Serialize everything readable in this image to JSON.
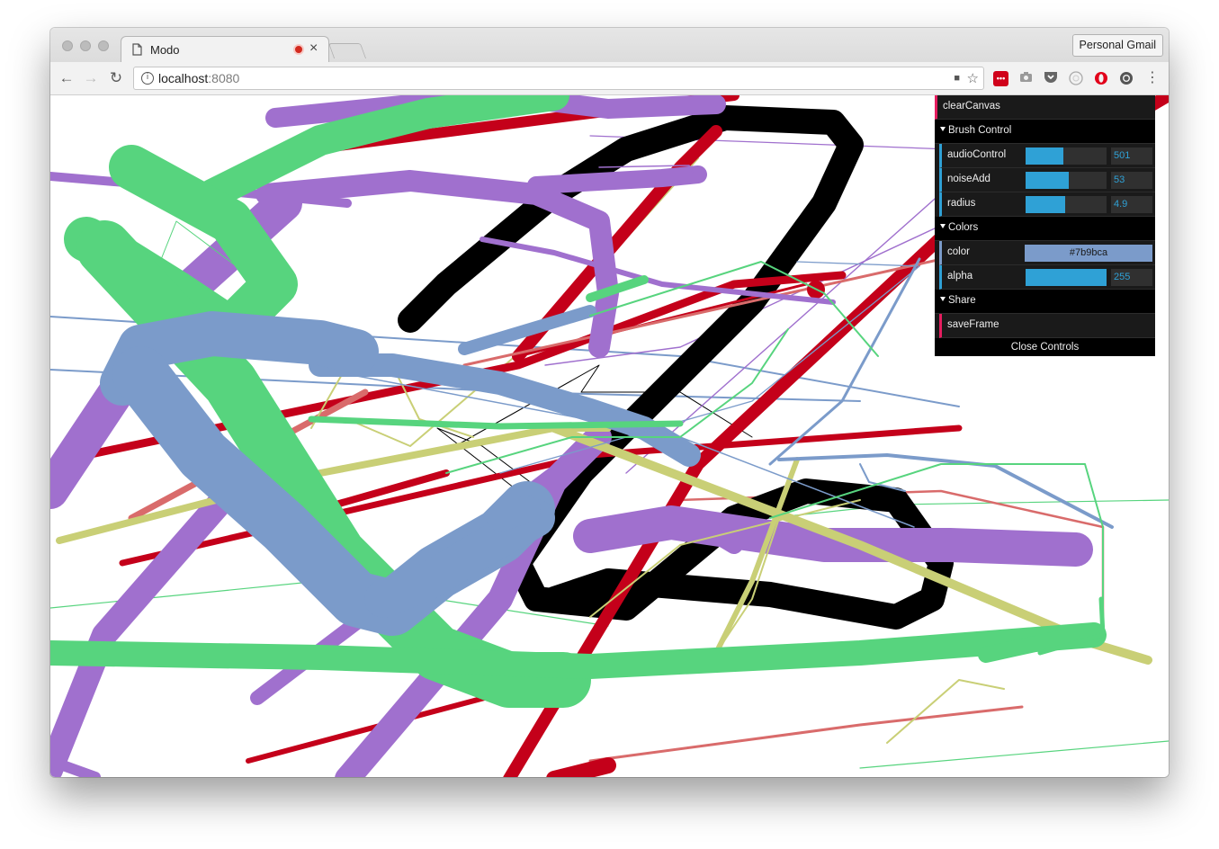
{
  "browser": {
    "tab_title": "Modo",
    "tab_close": "×",
    "profile_button": "Personal Gmail",
    "url_host": "localhost",
    "url_port": ":8080",
    "info_glyph": "i",
    "back_glyph": "←",
    "forward_glyph": "→",
    "reload_glyph": "↻",
    "camera_glyph": "■",
    "star_glyph": "☆",
    "menu_glyph": "⋮",
    "extensions": [
      "lastpass-icon",
      "camera-icon",
      "pocket-icon",
      "ghostery-icon",
      "opera-icon",
      "record-icon"
    ]
  },
  "gui": {
    "clear_canvas": "clearCanvas",
    "brush_control": {
      "title": "Brush Control",
      "controls": [
        {
          "label": "audioControl",
          "value": "501",
          "fill": 0.47
        },
        {
          "label": "noiseAdd",
          "value": "53",
          "fill": 0.53
        },
        {
          "label": "radius",
          "value": "4.9",
          "fill": 0.49
        }
      ]
    },
    "colors": {
      "title": "Colors",
      "color_label": "color",
      "color_value": "#7b9bca",
      "alpha_label": "alpha",
      "alpha_value": "255",
      "alpha_fill": 1.0
    },
    "share": {
      "title": "Share",
      "save_frame": "saveFrame"
    },
    "close_controls": "Close Controls"
  },
  "palette": {
    "green": "#57d47e",
    "purple": "#a070ce",
    "black": "#000000",
    "red": "#c4001a",
    "blue": "#7b9bca",
    "olive": "#c9cf76",
    "salmon": "#d96b6b",
    "gui_accent": "#2fa1d6",
    "gui_function": "#e61d5f"
  }
}
